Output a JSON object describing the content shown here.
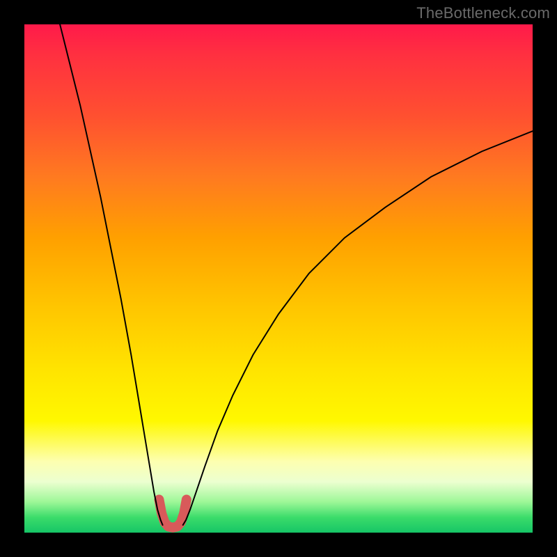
{
  "watermark": {
    "text": "TheBottleneck.com"
  },
  "chart_data": {
    "type": "line",
    "title": "",
    "xlabel": "",
    "ylabel": "",
    "xlim": [
      0,
      100
    ],
    "ylim": [
      0,
      100
    ],
    "grid": false,
    "legend": false,
    "annotations": [],
    "series": [
      {
        "name": "left-branch",
        "stroke": "#000000",
        "stroke_width": 2,
        "x": [
          7,
          9,
          11,
          13,
          15,
          17,
          19,
          21,
          23,
          24.5,
          25.5,
          26.2,
          26.8,
          27.2
        ],
        "y": [
          100,
          92,
          84,
          75,
          66,
          56,
          46,
          35,
          23,
          14,
          8,
          4.5,
          2.5,
          1.5
        ]
      },
      {
        "name": "right-branch",
        "stroke": "#000000",
        "stroke_width": 2,
        "x": [
          31.2,
          31.8,
          32.6,
          33.8,
          35.5,
          38,
          41,
          45,
          50,
          56,
          63,
          71,
          80,
          90,
          100
        ],
        "y": [
          1.5,
          2.5,
          4.5,
          8,
          13,
          20,
          27,
          35,
          43,
          51,
          58,
          64,
          70,
          75,
          79
        ]
      },
      {
        "name": "trough-highlight",
        "stroke": "#d85a5a",
        "stroke_width": 14,
        "linecap": "round",
        "x": [
          26.5,
          27.0,
          27.6,
          28.3,
          29.2,
          30.1,
          30.8,
          31.4,
          31.9
        ],
        "y": [
          6.5,
          3.8,
          2.0,
          1.2,
          1.0,
          1.2,
          2.0,
          3.8,
          6.5
        ]
      }
    ]
  }
}
